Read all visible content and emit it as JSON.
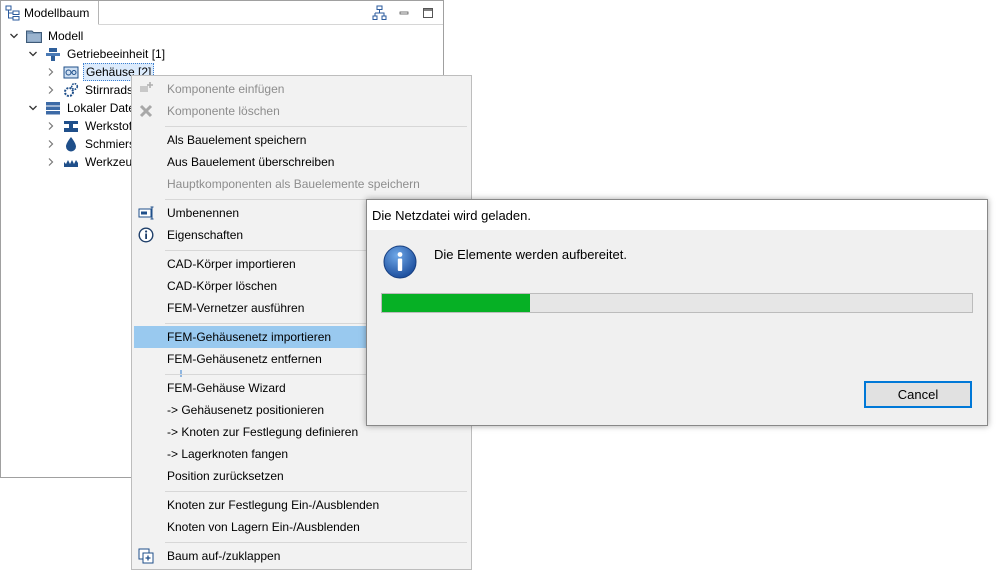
{
  "panel": {
    "title": "Modellbaum"
  },
  "tree": {
    "root": "Modell",
    "getriebe": "Getriebeeinheit [1]",
    "gehaeuse": "Gehäuse [2]",
    "stirnrad": "Stirnradst",
    "lokal": "Lokaler Date",
    "werkstoff": "Werkstof",
    "schmier": "Schmiers",
    "werkzeug": "Werkzeug"
  },
  "menu": {
    "komponente_einfuegen": "Komponente einfügen",
    "komponente_loeschen": "Komponente löschen",
    "als_bauelement": "Als Bauelement speichern",
    "aus_bauelement": "Aus Bauelement überschreiben",
    "hauptkomponenten": "Hauptkomponenten als Bauelemente speichern",
    "umbenennen": "Umbenennen",
    "eigenschaften": "Eigenschaften",
    "cad_import": "CAD-Körper importieren",
    "cad_loeschen": "CAD-Körper löschen",
    "fem_vernetzer": "FEM-Vernetzer ausführen",
    "fem_netz_import": "FEM-Gehäusenetz importieren",
    "fem_netz_entfernen": "FEM-Gehäusenetz entfernen",
    "fem_wizard": "FEM-Gehäuse Wizard",
    "netz_positionieren": "->  Gehäusenetz positionieren",
    "knoten_festlegung": "->  Knoten zur Festlegung definieren",
    "lagerknoten": "->  Lagerknoten fangen",
    "position_reset": "Position zurücksetzen",
    "knoten_festlegung_toggle": "Knoten zur Festlegung Ein-/Ausblenden",
    "knoten_lager_toggle": "Knoten von Lagern Ein-/Ausblenden",
    "baum_toggle": "Baum auf-/zuklappen"
  },
  "dialog": {
    "title": "Die Netzdatei wird geladen.",
    "message": "Die Elemente werden aufbereitet.",
    "progress": 0.25,
    "cancel": "Cancel"
  },
  "colors": {
    "highlight": "#99c9ef",
    "progress": "#06b025",
    "focus_border": "#0078d7"
  }
}
